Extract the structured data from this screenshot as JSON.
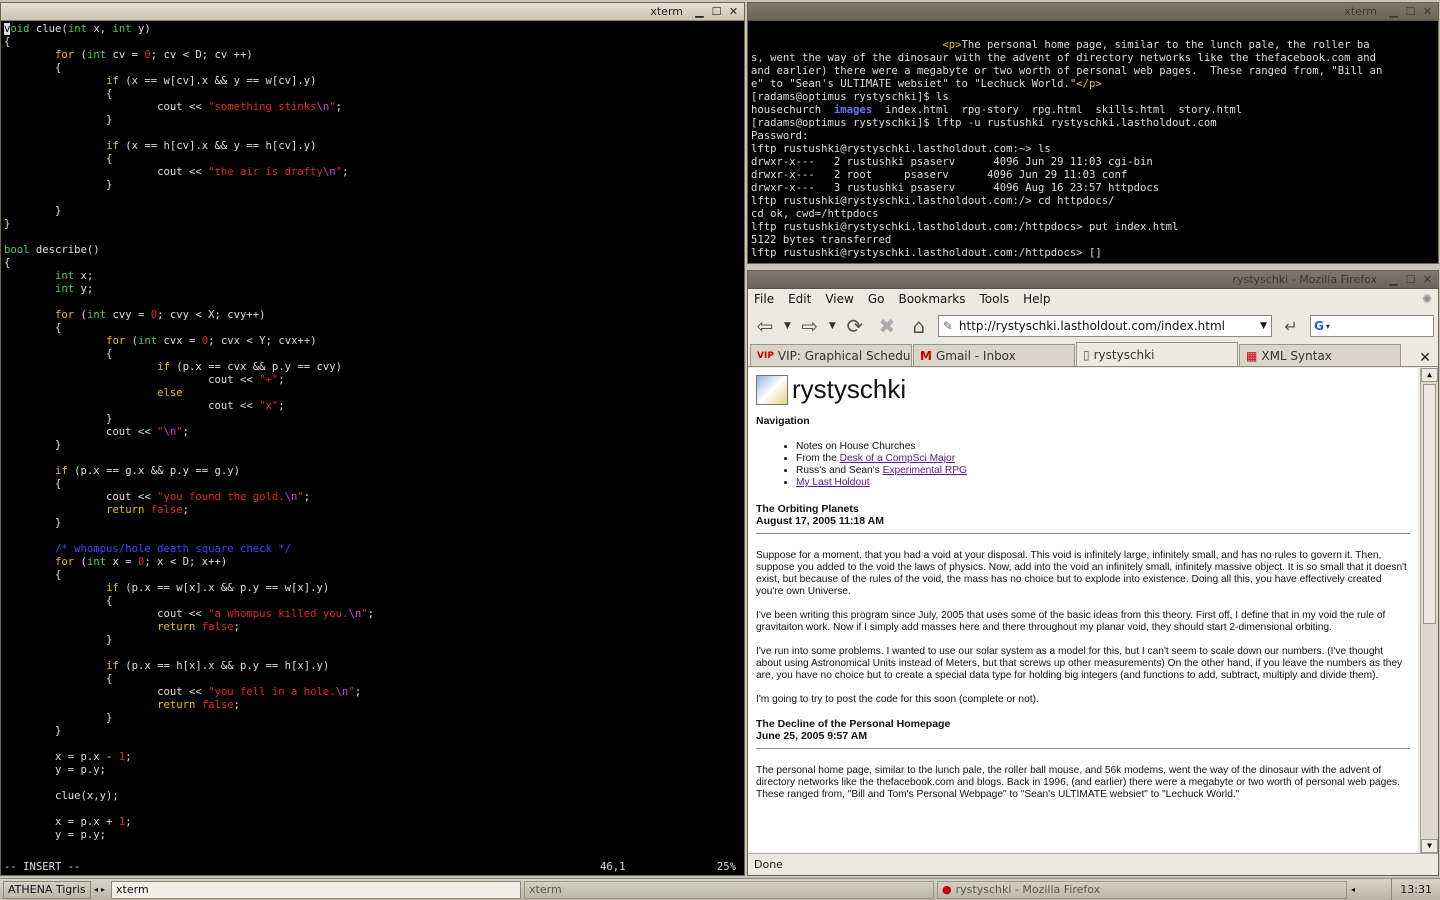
{
  "vim": {
    "title": "xterm",
    "mode": "-- INSERT --",
    "position": "46,1",
    "percent": "25%",
    "lines": [
      [
        [
          "cursor",
          "v"
        ],
        [
          "g",
          "oid"
        ],
        [
          "w",
          " clue("
        ],
        [
          "g",
          "int"
        ],
        [
          "w",
          " x, "
        ],
        [
          "g",
          "int"
        ],
        [
          "w",
          " y)"
        ]
      ],
      [
        [
          "w",
          "{"
        ]
      ],
      [
        [
          "w",
          "        "
        ],
        [
          "y",
          "for"
        ],
        [
          "w",
          " ("
        ],
        [
          "g",
          "int"
        ],
        [
          "w",
          " cv = "
        ],
        [
          "r",
          "0"
        ],
        [
          "w",
          "; cv < D; cv ++)"
        ]
      ],
      [
        [
          "w",
          "        {"
        ]
      ],
      [
        [
          "w",
          "                "
        ],
        [
          "y",
          "if"
        ],
        [
          "w",
          " (x == w[cv].x && y == w[cv].y)"
        ]
      ],
      [
        [
          "w",
          "                {"
        ]
      ],
      [
        [
          "w",
          "                        cout << "
        ],
        [
          "r",
          "\"something stinks"
        ],
        [
          "m",
          "\\n"
        ],
        [
          "r",
          "\""
        ],
        [
          "w",
          ";"
        ]
      ],
      [
        [
          "w",
          "                }"
        ]
      ],
      [
        [
          "w",
          ""
        ]
      ],
      [
        [
          "w",
          "                "
        ],
        [
          "y",
          "if"
        ],
        [
          "w",
          " (x == h[cv].x && y == h[cv].y)"
        ]
      ],
      [
        [
          "w",
          "                {"
        ]
      ],
      [
        [
          "w",
          "                        cout << "
        ],
        [
          "r",
          "\"the air is drafty"
        ],
        [
          "m",
          "\\n"
        ],
        [
          "r",
          "\""
        ],
        [
          "w",
          ";"
        ]
      ],
      [
        [
          "w",
          "                }"
        ]
      ],
      [
        [
          "w",
          ""
        ]
      ],
      [
        [
          "w",
          "        }"
        ]
      ],
      [
        [
          "w",
          "}"
        ]
      ],
      [
        [
          "w",
          ""
        ]
      ],
      [
        [
          "g",
          "bool"
        ],
        [
          "w",
          " describe()"
        ]
      ],
      [
        [
          "w",
          "{"
        ]
      ],
      [
        [
          "w",
          "        "
        ],
        [
          "g",
          "int"
        ],
        [
          "w",
          " x;"
        ]
      ],
      [
        [
          "w",
          "        "
        ],
        [
          "g",
          "int"
        ],
        [
          "w",
          " y;"
        ]
      ],
      [
        [
          "w",
          ""
        ]
      ],
      [
        [
          "w",
          "        "
        ],
        [
          "y",
          "for"
        ],
        [
          "w",
          " ("
        ],
        [
          "g",
          "int"
        ],
        [
          "w",
          " cvy = "
        ],
        [
          "r",
          "0"
        ],
        [
          "w",
          "; cvy < X; cvy++)"
        ]
      ],
      [
        [
          "w",
          "        {"
        ]
      ],
      [
        [
          "w",
          "                "
        ],
        [
          "y",
          "for"
        ],
        [
          "w",
          " ("
        ],
        [
          "g",
          "int"
        ],
        [
          "w",
          " cvx = "
        ],
        [
          "r",
          "0"
        ],
        [
          "w",
          "; cvx < Y; cvx++)"
        ]
      ],
      [
        [
          "w",
          "                {"
        ]
      ],
      [
        [
          "w",
          "                        "
        ],
        [
          "y",
          "if"
        ],
        [
          "w",
          " (p.x == cvx && p.y == cvy)"
        ]
      ],
      [
        [
          "w",
          "                                cout << "
        ],
        [
          "r",
          "\"+\""
        ],
        [
          "w",
          ";"
        ]
      ],
      [
        [
          "w",
          "                        "
        ],
        [
          "y",
          "else"
        ]
      ],
      [
        [
          "w",
          "                                cout << "
        ],
        [
          "r",
          "\"x\""
        ],
        [
          "w",
          ";"
        ]
      ],
      [
        [
          "w",
          "                }"
        ]
      ],
      [
        [
          "w",
          "                cout << "
        ],
        [
          "r",
          "\""
        ],
        [
          "m",
          "\\n"
        ],
        [
          "r",
          "\""
        ],
        [
          "w",
          ";"
        ]
      ],
      [
        [
          "w",
          "        }"
        ]
      ],
      [
        [
          "w",
          ""
        ]
      ],
      [
        [
          "w",
          "        "
        ],
        [
          "y",
          "if"
        ],
        [
          "w",
          " (p.x == g.x && p.y == g.y)"
        ]
      ],
      [
        [
          "w",
          "        {"
        ]
      ],
      [
        [
          "w",
          "                cout << "
        ],
        [
          "r",
          "\"you found the gold."
        ],
        [
          "m",
          "\\n"
        ],
        [
          "r",
          "\""
        ],
        [
          "w",
          ";"
        ]
      ],
      [
        [
          "w",
          "                "
        ],
        [
          "y",
          "return"
        ],
        [
          "w",
          " "
        ],
        [
          "r",
          "false"
        ],
        [
          "w",
          ";"
        ]
      ],
      [
        [
          "w",
          "        }"
        ]
      ],
      [
        [
          "w",
          ""
        ]
      ],
      [
        [
          "w",
          "        "
        ],
        [
          "b",
          "/* whompus/hole death square check */"
        ]
      ],
      [
        [
          "w",
          "        "
        ],
        [
          "y",
          "for"
        ],
        [
          "w",
          " ("
        ],
        [
          "g",
          "int"
        ],
        [
          "w",
          " x = "
        ],
        [
          "r",
          "0"
        ],
        [
          "w",
          "; x < D; x++)"
        ]
      ],
      [
        [
          "w",
          "        {"
        ]
      ],
      [
        [
          "w",
          "                "
        ],
        [
          "y",
          "if"
        ],
        [
          "w",
          " (p.x == w[x].x && p.y == w[x].y)"
        ]
      ],
      [
        [
          "w",
          "                {"
        ]
      ],
      [
        [
          "w",
          "                        cout << "
        ],
        [
          "r",
          "\"a whompus killed you."
        ],
        [
          "m",
          "\\n"
        ],
        [
          "r",
          "\""
        ],
        [
          "w",
          ";"
        ]
      ],
      [
        [
          "w",
          "                        "
        ],
        [
          "y",
          "return"
        ],
        [
          "w",
          " "
        ],
        [
          "r",
          "false"
        ],
        [
          "w",
          ";"
        ]
      ],
      [
        [
          "w",
          "                }"
        ]
      ],
      [
        [
          "w",
          ""
        ]
      ],
      [
        [
          "w",
          "                "
        ],
        [
          "y",
          "if"
        ],
        [
          "w",
          " (p.x == h[x].x && p.y == h[x].y)"
        ]
      ],
      [
        [
          "w",
          "                {"
        ]
      ],
      [
        [
          "w",
          "                        cout << "
        ],
        [
          "r",
          "\"you fell in a hole."
        ],
        [
          "m",
          "\\n"
        ],
        [
          "r",
          "\""
        ],
        [
          "w",
          ";"
        ]
      ],
      [
        [
          "w",
          "                        "
        ],
        [
          "y",
          "return"
        ],
        [
          "w",
          " "
        ],
        [
          "r",
          "false"
        ],
        [
          "w",
          ";"
        ]
      ],
      [
        [
          "w",
          "                }"
        ]
      ],
      [
        [
          "w",
          "        }"
        ]
      ],
      [
        [
          "w",
          ""
        ]
      ],
      [
        [
          "w",
          "        x = p.x - "
        ],
        [
          "r",
          "1"
        ],
        [
          "w",
          ";"
        ]
      ],
      [
        [
          "w",
          "        y = p.y;"
        ]
      ],
      [
        [
          "w",
          ""
        ]
      ],
      [
        [
          "w",
          "        clue(x,y);"
        ]
      ],
      [
        [
          "w",
          ""
        ]
      ],
      [
        [
          "w",
          "        x = p.x + "
        ],
        [
          "r",
          "1"
        ],
        [
          "w",
          ";"
        ]
      ],
      [
        [
          "w",
          "        y = p.y;"
        ]
      ]
    ]
  },
  "shell": {
    "title": "xterm",
    "lines": [
      [
        [
          "w",
          "                              "
        ],
        [
          "y",
          "<p>"
        ],
        [
          "w",
          "The personal home page, similar to the lunch pale, the roller ba"
        ]
      ],
      [
        [
          "w",
          "s, went the way of the dinosaur with the advent of directory networks like the thefacebook.com and"
        ]
      ],
      [
        [
          "w",
          "and earlier) there were a megabyte or two worth of personal web pages.  These ranged from, \"Bill an"
        ]
      ],
      [
        [
          "w",
          "e\" to \"Sean's ULTIMATE websiet\" to \"Lechuck World.\""
        ],
        [
          "y",
          "</p>"
        ]
      ],
      [
        [
          "w",
          "[radams@optimus rystyschki]$ ls"
        ]
      ],
      [
        [
          "w",
          "housechurch  "
        ],
        [
          "blu",
          "images"
        ],
        [
          "w",
          "  index.html  rpg-story  rpg.html  skills.html  story.html"
        ]
      ],
      [
        [
          "w",
          "[radams@optimus rystyschki]$ lftp -u rustushki rystyschki.lastholdout.com"
        ]
      ],
      [
        [
          "w",
          "Password:"
        ]
      ],
      [
        [
          "w",
          "lftp rustushki@rystyschki.lastholdout.com:~> ls"
        ]
      ],
      [
        [
          "w",
          "drwxr-x---   2 rustushki psaserv      4096 Jun 29 11:03 cgi-bin"
        ]
      ],
      [
        [
          "w",
          "drwxr-x---   2 root     psaserv      4096 Jun 29 11:03 conf"
        ]
      ],
      [
        [
          "w",
          "drwxr-x---   3 rustushki psaserv      4096 Aug 16 23:57 httpdocs"
        ]
      ],
      [
        [
          "w",
          "lftp rustushki@rystyschki.lastholdout.com:/> cd httpdocs/"
        ]
      ],
      [
        [
          "w",
          "cd ok, cwd=/httpdocs"
        ]
      ],
      [
        [
          "w",
          "lftp rustushki@rystyschki.lastholdout.com:/httpdocs> put index.html"
        ]
      ],
      [
        [
          "w",
          "5122 bytes transferred"
        ]
      ],
      [
        [
          "w",
          "lftp rustushki@rystyschki.lastholdout.com:/httpdocs> "
        ],
        [
          "w",
          "[]"
        ]
      ]
    ]
  },
  "firefox": {
    "window_title": "rystyschki - Mozilla Firefox",
    "menu": [
      "File",
      "Edit",
      "View",
      "Go",
      "Bookmarks",
      "Tools",
      "Help"
    ],
    "url": "http://rystyschki.lastholdout.com/index.html",
    "tabs": [
      {
        "label": "VIP: Graphical Schedule",
        "icon": "vip-icon"
      },
      {
        "label": "Gmail - Inbox",
        "icon": "gmail-icon"
      },
      {
        "label": "rystyschki",
        "icon": "page-icon"
      },
      {
        "label": "XML Syntax",
        "icon": "xml-icon"
      }
    ],
    "status": "Done",
    "page": {
      "site_title": "rystyschki",
      "nav_heading": "Navigation",
      "nav": [
        {
          "prefix": "Notes on House Churches",
          "link": ""
        },
        {
          "prefix": "From the ",
          "link": "Desk of a CompSci Major"
        },
        {
          "prefix": "Russ's and Sean's ",
          "link": "Experimental RPG"
        },
        {
          "prefix": "",
          "link": "My Last Holdout"
        }
      ],
      "posts": [
        {
          "title": "The Orbiting Planets",
          "date": "August 17, 2005 11:18 AM",
          "paragraphs": [
            "Suppose for a moment, that you had a void at your disposal. This void is infinitely large, infinitely small, and has no rules to govern it. Then, suppose you added to the void the laws of physics. Now, add into the void an infinitely small, infinitely massive object. It is so small that it doesn't exist, but because of the rules of the void, the mass has no choice but to explode into existence. Doing all this, you have effectively created you're own Universe.",
            "I've been writing this program since July, 2005 that uses some of the basic ideas from this theory. First off, I define that in my void the rule of gravitaiton work. Now if I simply add masses here and there throughout my planar void, they should start 2-dimensional orbiting.",
            "I've run into some problems. I wanted to use our solar system as a model for this, but I can't seem to scale down our numbers. (I've thought about using Astronomical Units instead of Meters, but that screws up other measurements) On the other hand, if you leave the numbers as they are, you have no choice but to create a special data type for holding big integers (and functions to add, subtract, multiply and divide them).",
            "I'm going to try to post the code for this soon (complete or not)."
          ]
        },
        {
          "title": "The Decline of the Personal Homepage",
          "date": "June 25, 2005 9:57 AM",
          "paragraphs": [
            "The personal home page, similar to the lunch pale, the roller ball mouse, and 56k modems, went the way of the dinosaur with the advent of directory networks like the thefacebook.com and blogs. Back in 1996, (and earlier) there were a megabyte or two worth of personal web pages. These ranged from, \"Bill and Tom's Personal Webpage\" to \"Sean's ULTIMATE websiet\" to \"Lechuck World.\""
          ]
        }
      ]
    }
  },
  "taskbar": {
    "items": [
      {
        "label": "ATHENA Tigris",
        "state": "normal"
      },
      {
        "label": "xterm",
        "state": "pressed"
      },
      {
        "label": "xterm",
        "state": "dim"
      },
      {
        "label": "rystyschki - Mozilla Firefox",
        "state": "dim"
      }
    ],
    "clock": "13:31"
  }
}
